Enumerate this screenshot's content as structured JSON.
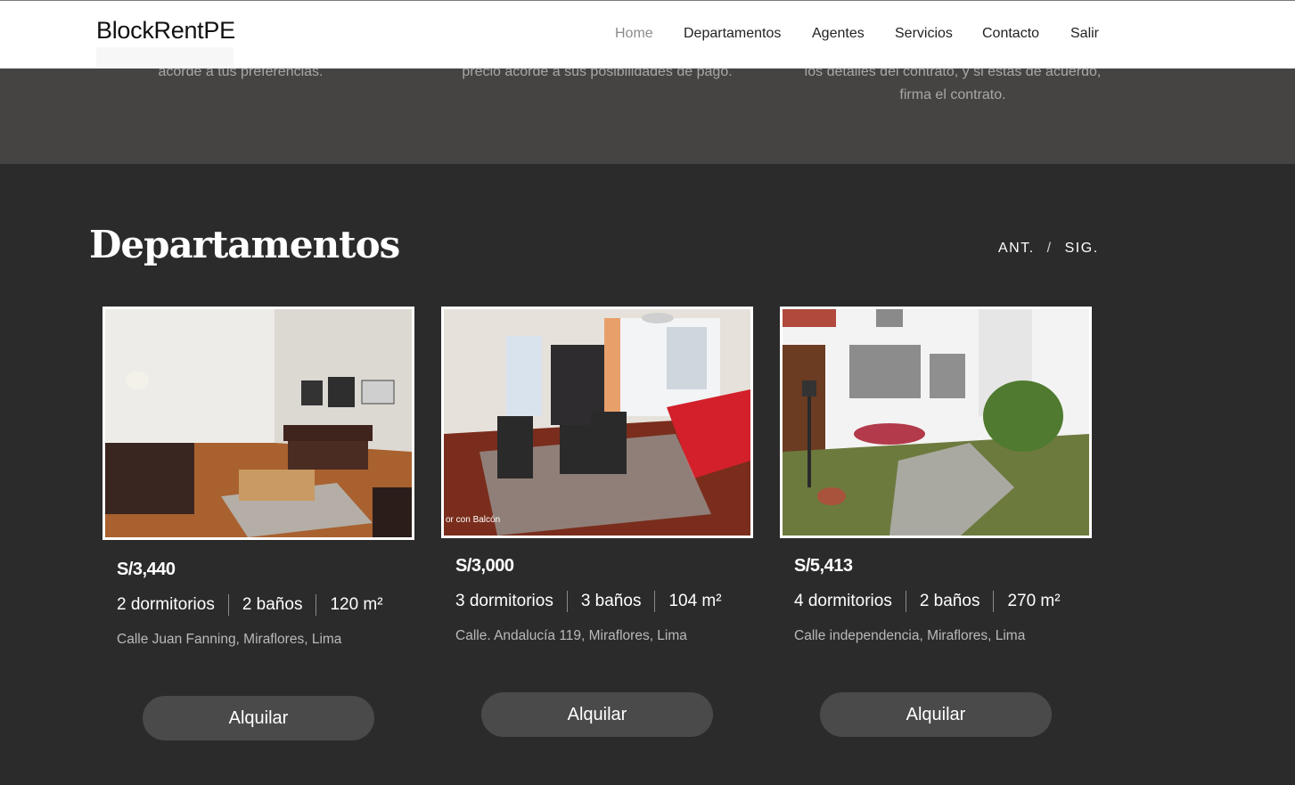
{
  "brand": "BlockRentPE",
  "nav": {
    "home": "Home",
    "departamentos": "Departamentos",
    "agentes": "Agentes",
    "servicios": "Servicios",
    "contacto": "Contacto",
    "salir": "Salir"
  },
  "steps": {
    "left": "acorde a tus preferencias.",
    "middle": "precio acorde a sus posibilidades de pago.",
    "right_line1": "los detalles del contrato, y si estás de acuerdo,",
    "right_line2": "firma el contrato."
  },
  "section": {
    "title": "Departamentos",
    "prev": "ANT.",
    "separator": "/",
    "next": "SIG."
  },
  "listings": [
    {
      "price": "S/3,440",
      "bedrooms": "2 dormitorios",
      "bathrooms": "2 baños",
      "area": "120 m²",
      "address": "Calle Juan Fanning, Miraflores, Lima",
      "button": "Alquilar"
    },
    {
      "price": "S/3,000",
      "bedrooms": "3 dormitorios",
      "bathrooms": "3 baños",
      "area": "104 m²",
      "address": "Calle. Andalucía 119, Miraflores, Lima",
      "button": "Alquilar",
      "photo_caption": "or con Balcón"
    },
    {
      "price": "S/5,413",
      "bedrooms": "4 dormitorios",
      "bathrooms": "2 baños",
      "area": "270 m²",
      "address": "Calle independencia, Miraflores, Lima",
      "button": "Alquilar"
    }
  ]
}
